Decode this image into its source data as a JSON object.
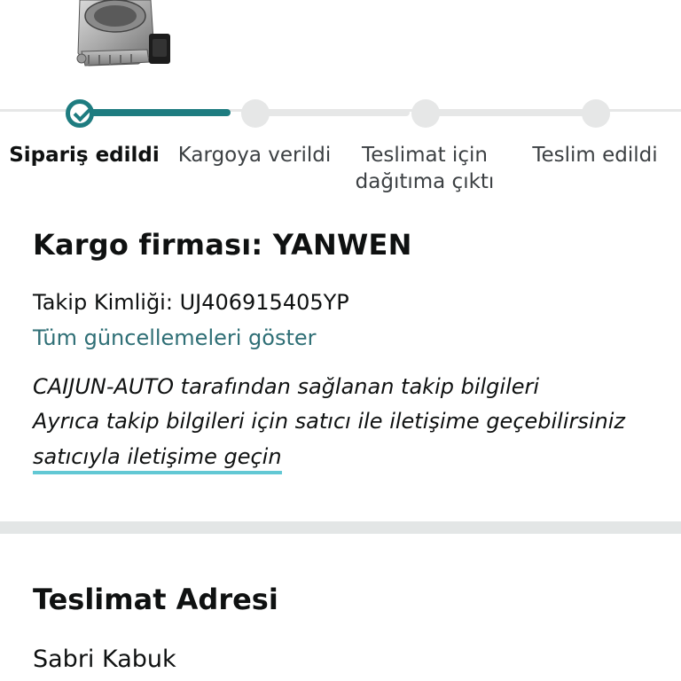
{
  "product": {
    "image_icon": "throttle-body-product-image"
  },
  "tracker": {
    "steps": [
      {
        "label": "Sipariş edildi",
        "state": "done"
      },
      {
        "label": "Kargoya verildi",
        "state": "pending"
      },
      {
        "label": "Teslimat için dağıtıma çıktı",
        "state": "pending"
      },
      {
        "label": "Teslim edildi",
        "state": "pending"
      }
    ],
    "active_color": "#1e7c80",
    "inactive_color": "#e6e7e7"
  },
  "carrier": {
    "title": "Kargo firması: YANWEN",
    "tracking_label": "Takip Kimliği: UJ406915405YP",
    "all_updates_link": "Tüm güncellemeleri göster",
    "provided_by": "CAIJUN-AUTO tarafından sağlanan takip bilgileri",
    "contact_hint": "Ayrıca takip bilgileri için satıcı ile iletişime geçebilirsiniz",
    "contact_link": "satıcıyla iletişime geçin"
  },
  "address": {
    "title": "Teslimat Adresi",
    "name": "Sabri Kabuk"
  },
  "colors": {
    "link": "#2f6f76",
    "accent_underline": "#62c8d4"
  }
}
